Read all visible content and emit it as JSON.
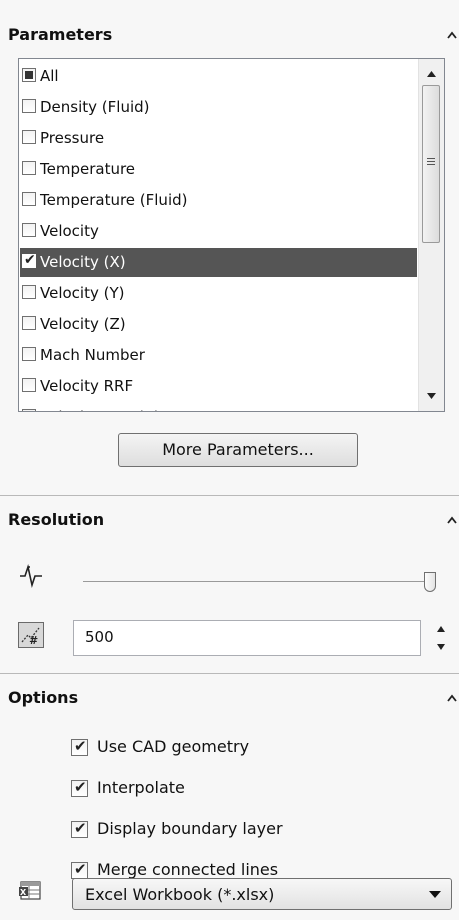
{
  "parameters": {
    "title": "Parameters",
    "items": [
      {
        "label": "All",
        "state": "indeterminate",
        "selected": false
      },
      {
        "label": "Density (Fluid)",
        "state": "unchecked",
        "selected": false
      },
      {
        "label": "Pressure",
        "state": "unchecked",
        "selected": false
      },
      {
        "label": "Temperature",
        "state": "unchecked",
        "selected": false
      },
      {
        "label": "Temperature (Fluid)",
        "state": "unchecked",
        "selected": false
      },
      {
        "label": "Velocity",
        "state": "unchecked",
        "selected": false
      },
      {
        "label": "Velocity (X)",
        "state": "checked",
        "selected": true
      },
      {
        "label": "Velocity (Y)",
        "state": "unchecked",
        "selected": false
      },
      {
        "label": "Velocity (Z)",
        "state": "unchecked",
        "selected": false
      },
      {
        "label": "Mach Number",
        "state": "unchecked",
        "selected": false
      },
      {
        "label": "Velocity RRF",
        "state": "unchecked",
        "selected": false
      },
      {
        "label": "Velocity RRF (X)",
        "state": "unchecked",
        "selected": false
      }
    ],
    "more_button": "More Parameters..."
  },
  "resolution": {
    "title": "Resolution",
    "slider_level": 1.0,
    "value": "500"
  },
  "options": {
    "title": "Options",
    "checkboxes": [
      {
        "label": "Use CAD geometry",
        "checked": true
      },
      {
        "label": "Interpolate",
        "checked": true
      },
      {
        "label": "Display boundary layer",
        "checked": true
      },
      {
        "label": "Merge connected lines",
        "checked": true
      }
    ],
    "export_format": "Excel Workbook (*.xlsx)"
  },
  "colors": {
    "selection": "#555555",
    "panel": "#f7f7f7"
  }
}
